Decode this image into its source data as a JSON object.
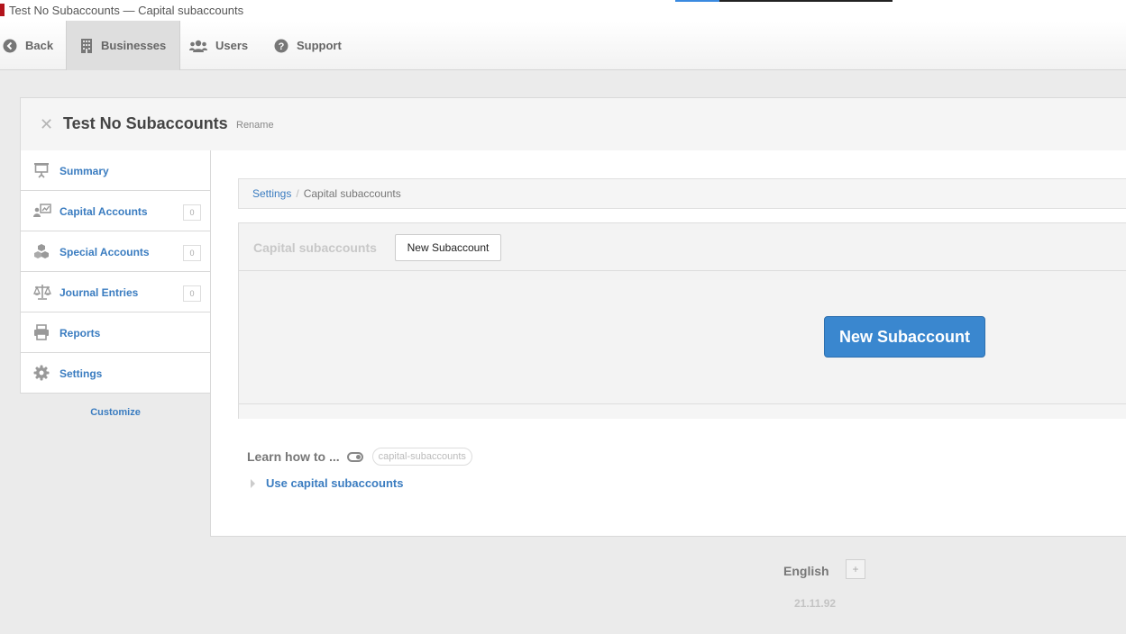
{
  "window": {
    "title": "Test No Subaccounts — Capital subaccounts"
  },
  "topnav": {
    "back": "Back",
    "businesses": "Businesses",
    "users": "Users",
    "support": "Support"
  },
  "business": {
    "name": "Test No Subaccounts",
    "rename": "Rename"
  },
  "sidebar": {
    "items": [
      {
        "label": "Summary",
        "icon": "presentation-icon"
      },
      {
        "label": "Capital Accounts",
        "count": "0",
        "icon": "capital-accounts-icon"
      },
      {
        "label": "Special Accounts",
        "count": "0",
        "icon": "cubes-icon"
      },
      {
        "label": "Journal Entries",
        "count": "0",
        "icon": "scale-icon"
      },
      {
        "label": "Reports",
        "icon": "printer-icon"
      },
      {
        "label": "Settings",
        "icon": "gear-icon"
      }
    ],
    "customize": "Customize"
  },
  "breadcrumb": {
    "parent": "Settings",
    "separator": "/",
    "current": "Capital subaccounts"
  },
  "subaccounts": {
    "title": "Capital subaccounts",
    "new_small": "New Subaccount",
    "new_primary": "New Subaccount"
  },
  "learn": {
    "label": "Learn how to ...",
    "tag": "capital-subaccounts",
    "topic": "Use capital subaccounts"
  },
  "footer": {
    "language": "English",
    "add": "+",
    "version": "21.11.92"
  },
  "colors": {
    "link": "#3a7cc0",
    "primary": "#3a87cf",
    "brand_mark": "#b3141c"
  }
}
